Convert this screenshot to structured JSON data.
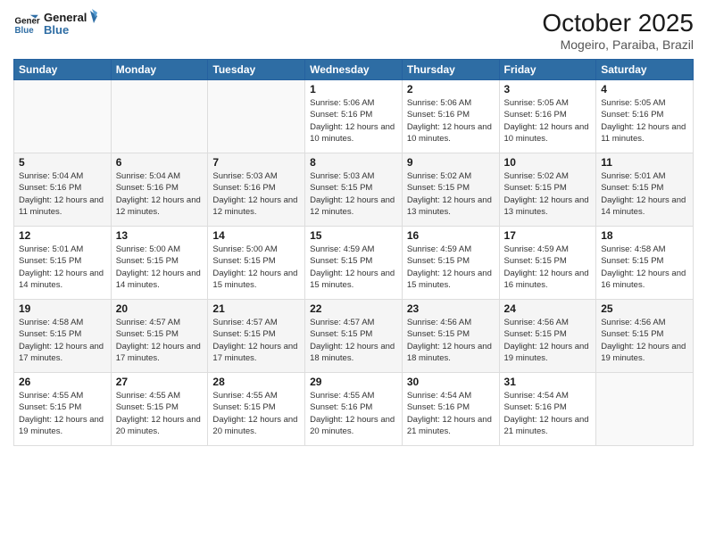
{
  "header": {
    "logo_line1": "General",
    "logo_line2": "Blue",
    "month_title": "October 2025",
    "location": "Mogeiro, Paraiba, Brazil"
  },
  "days_of_week": [
    "Sunday",
    "Monday",
    "Tuesday",
    "Wednesday",
    "Thursday",
    "Friday",
    "Saturday"
  ],
  "weeks": [
    [
      {
        "day": "",
        "info": ""
      },
      {
        "day": "",
        "info": ""
      },
      {
        "day": "",
        "info": ""
      },
      {
        "day": "1",
        "info": "Sunrise: 5:06 AM\nSunset: 5:16 PM\nDaylight: 12 hours and 10 minutes."
      },
      {
        "day": "2",
        "info": "Sunrise: 5:06 AM\nSunset: 5:16 PM\nDaylight: 12 hours and 10 minutes."
      },
      {
        "day": "3",
        "info": "Sunrise: 5:05 AM\nSunset: 5:16 PM\nDaylight: 12 hours and 10 minutes."
      },
      {
        "day": "4",
        "info": "Sunrise: 5:05 AM\nSunset: 5:16 PM\nDaylight: 12 hours and 11 minutes."
      }
    ],
    [
      {
        "day": "5",
        "info": "Sunrise: 5:04 AM\nSunset: 5:16 PM\nDaylight: 12 hours and 11 minutes."
      },
      {
        "day": "6",
        "info": "Sunrise: 5:04 AM\nSunset: 5:16 PM\nDaylight: 12 hours and 12 minutes."
      },
      {
        "day": "7",
        "info": "Sunrise: 5:03 AM\nSunset: 5:16 PM\nDaylight: 12 hours and 12 minutes."
      },
      {
        "day": "8",
        "info": "Sunrise: 5:03 AM\nSunset: 5:15 PM\nDaylight: 12 hours and 12 minutes."
      },
      {
        "day": "9",
        "info": "Sunrise: 5:02 AM\nSunset: 5:15 PM\nDaylight: 12 hours and 13 minutes."
      },
      {
        "day": "10",
        "info": "Sunrise: 5:02 AM\nSunset: 5:15 PM\nDaylight: 12 hours and 13 minutes."
      },
      {
        "day": "11",
        "info": "Sunrise: 5:01 AM\nSunset: 5:15 PM\nDaylight: 12 hours and 14 minutes."
      }
    ],
    [
      {
        "day": "12",
        "info": "Sunrise: 5:01 AM\nSunset: 5:15 PM\nDaylight: 12 hours and 14 minutes."
      },
      {
        "day": "13",
        "info": "Sunrise: 5:00 AM\nSunset: 5:15 PM\nDaylight: 12 hours and 14 minutes."
      },
      {
        "day": "14",
        "info": "Sunrise: 5:00 AM\nSunset: 5:15 PM\nDaylight: 12 hours and 15 minutes."
      },
      {
        "day": "15",
        "info": "Sunrise: 4:59 AM\nSunset: 5:15 PM\nDaylight: 12 hours and 15 minutes."
      },
      {
        "day": "16",
        "info": "Sunrise: 4:59 AM\nSunset: 5:15 PM\nDaylight: 12 hours and 15 minutes."
      },
      {
        "day": "17",
        "info": "Sunrise: 4:59 AM\nSunset: 5:15 PM\nDaylight: 12 hours and 16 minutes."
      },
      {
        "day": "18",
        "info": "Sunrise: 4:58 AM\nSunset: 5:15 PM\nDaylight: 12 hours and 16 minutes."
      }
    ],
    [
      {
        "day": "19",
        "info": "Sunrise: 4:58 AM\nSunset: 5:15 PM\nDaylight: 12 hours and 17 minutes."
      },
      {
        "day": "20",
        "info": "Sunrise: 4:57 AM\nSunset: 5:15 PM\nDaylight: 12 hours and 17 minutes."
      },
      {
        "day": "21",
        "info": "Sunrise: 4:57 AM\nSunset: 5:15 PM\nDaylight: 12 hours and 17 minutes."
      },
      {
        "day": "22",
        "info": "Sunrise: 4:57 AM\nSunset: 5:15 PM\nDaylight: 12 hours and 18 minutes."
      },
      {
        "day": "23",
        "info": "Sunrise: 4:56 AM\nSunset: 5:15 PM\nDaylight: 12 hours and 18 minutes."
      },
      {
        "day": "24",
        "info": "Sunrise: 4:56 AM\nSunset: 5:15 PM\nDaylight: 12 hours and 19 minutes."
      },
      {
        "day": "25",
        "info": "Sunrise: 4:56 AM\nSunset: 5:15 PM\nDaylight: 12 hours and 19 minutes."
      }
    ],
    [
      {
        "day": "26",
        "info": "Sunrise: 4:55 AM\nSunset: 5:15 PM\nDaylight: 12 hours and 19 minutes."
      },
      {
        "day": "27",
        "info": "Sunrise: 4:55 AM\nSunset: 5:15 PM\nDaylight: 12 hours and 20 minutes."
      },
      {
        "day": "28",
        "info": "Sunrise: 4:55 AM\nSunset: 5:15 PM\nDaylight: 12 hours and 20 minutes."
      },
      {
        "day": "29",
        "info": "Sunrise: 4:55 AM\nSunset: 5:16 PM\nDaylight: 12 hours and 20 minutes."
      },
      {
        "day": "30",
        "info": "Sunrise: 4:54 AM\nSunset: 5:16 PM\nDaylight: 12 hours and 21 minutes."
      },
      {
        "day": "31",
        "info": "Sunrise: 4:54 AM\nSunset: 5:16 PM\nDaylight: 12 hours and 21 minutes."
      },
      {
        "day": "",
        "info": ""
      }
    ]
  ]
}
